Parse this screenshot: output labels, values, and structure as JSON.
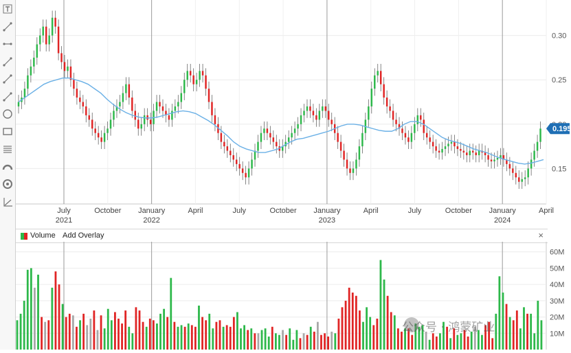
{
  "chart_data": [
    {
      "type": "candlestick",
      "title": "",
      "y_ticks": [
        "0.30",
        "0.25",
        "0.20",
        "0.15"
      ],
      "ylim": [
        0.11,
        0.34
      ],
      "last_price_label": "0.195",
      "x_labels": [
        {
          "month": "July",
          "year": "2021"
        },
        {
          "month": "October",
          "year": ""
        },
        {
          "month": "January",
          "year": "2022"
        },
        {
          "month": "April",
          "year": ""
        },
        {
          "month": "July",
          "year": ""
        },
        {
          "month": "October",
          "year": ""
        },
        {
          "month": "January",
          "year": "2023"
        },
        {
          "month": "April",
          "year": ""
        },
        {
          "month": "July",
          "year": ""
        },
        {
          "month": "October",
          "year": ""
        },
        {
          "month": "January",
          "year": "2024"
        },
        {
          "month": "April",
          "year": ""
        }
      ],
      "series": [
        {
          "style": "candle",
          "close": [
            0.225,
            0.23,
            0.24,
            0.255,
            0.265,
            0.275,
            0.29,
            0.3,
            0.31,
            0.29,
            0.3,
            0.32,
            0.31,
            0.28,
            0.27,
            0.26,
            0.265,
            0.25,
            0.24,
            0.23,
            0.225,
            0.22,
            0.21,
            0.205,
            0.195,
            0.19,
            0.185,
            0.18,
            0.19,
            0.195,
            0.205,
            0.215,
            0.22,
            0.225,
            0.235,
            0.245,
            0.23,
            0.215,
            0.205,
            0.195,
            0.2,
            0.21,
            0.205,
            0.2,
            0.215,
            0.225,
            0.22,
            0.215,
            0.21,
            0.205,
            0.215,
            0.22,
            0.225,
            0.235,
            0.25,
            0.26,
            0.255,
            0.245,
            0.25,
            0.26,
            0.255,
            0.24,
            0.225,
            0.21,
            0.2,
            0.19,
            0.18,
            0.175,
            0.17,
            0.165,
            0.16,
            0.155,
            0.15,
            0.145,
            0.14,
            0.15,
            0.16,
            0.17,
            0.18,
            0.19,
            0.195,
            0.19,
            0.185,
            0.18,
            0.175,
            0.17,
            0.175,
            0.18,
            0.185,
            0.19,
            0.195,
            0.2,
            0.21,
            0.215,
            0.22,
            0.215,
            0.21,
            0.205,
            0.215,
            0.22,
            0.215,
            0.205,
            0.2,
            0.19,
            0.18,
            0.17,
            0.16,
            0.15,
            0.145,
            0.15,
            0.16,
            0.175,
            0.19,
            0.205,
            0.22,
            0.24,
            0.255,
            0.26,
            0.245,
            0.23,
            0.22,
            0.215,
            0.205,
            0.2,
            0.195,
            0.19,
            0.185,
            0.18,
            0.19,
            0.2,
            0.21,
            0.205,
            0.19,
            0.185,
            0.18,
            0.175,
            0.17,
            0.168,
            0.172,
            0.175,
            0.178,
            0.18,
            0.175,
            0.172,
            0.17,
            0.168,
            0.165,
            0.17,
            0.168,
            0.165,
            0.17,
            0.168,
            0.165,
            0.16,
            0.158,
            0.16,
            0.162,
            0.165,
            0.16,
            0.155,
            0.15,
            0.145,
            0.14,
            0.135,
            0.138,
            0.14,
            0.15,
            0.16,
            0.17,
            0.18,
            0.195
          ],
          "open": [
            0.22,
            0.225,
            0.23,
            0.24,
            0.255,
            0.265,
            0.275,
            0.29,
            0.3,
            0.31,
            0.29,
            0.3,
            0.32,
            0.31,
            0.28,
            0.27,
            0.26,
            0.265,
            0.25,
            0.24,
            0.23,
            0.225,
            0.22,
            0.21,
            0.205,
            0.195,
            0.19,
            0.185,
            0.18,
            0.19,
            0.195,
            0.205,
            0.215,
            0.22,
            0.225,
            0.235,
            0.245,
            0.23,
            0.215,
            0.205,
            0.195,
            0.2,
            0.21,
            0.205,
            0.2,
            0.215,
            0.225,
            0.22,
            0.215,
            0.21,
            0.205,
            0.215,
            0.22,
            0.225,
            0.235,
            0.25,
            0.26,
            0.255,
            0.245,
            0.25,
            0.26,
            0.255,
            0.24,
            0.225,
            0.21,
            0.2,
            0.19,
            0.18,
            0.175,
            0.17,
            0.165,
            0.16,
            0.155,
            0.15,
            0.145,
            0.14,
            0.15,
            0.16,
            0.17,
            0.18,
            0.19,
            0.195,
            0.19,
            0.185,
            0.18,
            0.175,
            0.17,
            0.175,
            0.18,
            0.185,
            0.19,
            0.195,
            0.2,
            0.21,
            0.215,
            0.22,
            0.215,
            0.21,
            0.205,
            0.215,
            0.22,
            0.215,
            0.205,
            0.2,
            0.19,
            0.18,
            0.17,
            0.16,
            0.15,
            0.145,
            0.15,
            0.16,
            0.175,
            0.19,
            0.205,
            0.22,
            0.24,
            0.255,
            0.26,
            0.245,
            0.23,
            0.22,
            0.215,
            0.205,
            0.2,
            0.195,
            0.19,
            0.185,
            0.18,
            0.19,
            0.2,
            0.21,
            0.205,
            0.19,
            0.185,
            0.18,
            0.175,
            0.17,
            0.168,
            0.172,
            0.175,
            0.178,
            0.18,
            0.175,
            0.172,
            0.17,
            0.168,
            0.165,
            0.17,
            0.168,
            0.165,
            0.17,
            0.168,
            0.165,
            0.16,
            0.158,
            0.16,
            0.162,
            0.165,
            0.16,
            0.155,
            0.15,
            0.145,
            0.14,
            0.135,
            0.138,
            0.14,
            0.15,
            0.16,
            0.17,
            0.18
          ]
        },
        {
          "style": "line",
          "color": "#6ab0e6",
          "values": [
            0.225,
            0.23,
            0.235,
            0.24,
            0.245,
            0.248,
            0.25,
            0.252,
            0.252,
            0.25,
            0.248,
            0.245,
            0.24,
            0.235,
            0.228,
            0.222,
            0.217,
            0.213,
            0.21,
            0.208,
            0.207,
            0.207,
            0.208,
            0.21,
            0.212,
            0.214,
            0.215,
            0.214,
            0.212,
            0.208,
            0.204,
            0.199,
            0.193,
            0.187,
            0.18,
            0.175,
            0.172,
            0.17,
            0.168,
            0.168,
            0.17,
            0.172,
            0.176,
            0.18,
            0.183,
            0.184,
            0.186,
            0.188,
            0.19,
            0.192,
            0.195,
            0.198,
            0.2,
            0.2,
            0.199,
            0.197,
            0.195,
            0.193,
            0.192,
            0.192,
            0.195,
            0.2,
            0.203,
            0.203,
            0.2,
            0.195,
            0.19,
            0.185,
            0.182,
            0.18,
            0.178,
            0.175,
            0.172,
            0.17,
            0.168,
            0.165,
            0.162,
            0.16,
            0.158,
            0.156,
            0.155,
            0.156,
            0.158,
            0.16
          ]
        }
      ]
    },
    {
      "type": "bar",
      "title": "",
      "y_ticks": [
        "60M",
        "50M",
        "40M",
        "30M",
        "20M",
        "10M"
      ],
      "ylim": [
        0,
        62
      ],
      "values": [
        18,
        22,
        30,
        49,
        50,
        38,
        46,
        20,
        17,
        18,
        38,
        48,
        40,
        28,
        20,
        22,
        21,
        14,
        18,
        22,
        15,
        19,
        24,
        12,
        21,
        13,
        25,
        18,
        23,
        19,
        16,
        24,
        14,
        10,
        26,
        24,
        17,
        14,
        19,
        18,
        16,
        22,
        25,
        20,
        44,
        17,
        14,
        15,
        14,
        16,
        15,
        14,
        27,
        20,
        18,
        22,
        13,
        17,
        18,
        14,
        15,
        14,
        20,
        23,
        13,
        15,
        12,
        13,
        10,
        10,
        12,
        13,
        8,
        14,
        10,
        9,
        12,
        9,
        13,
        6,
        12,
        7,
        10,
        9,
        14,
        11,
        17,
        9,
        10,
        8,
        11,
        10,
        19,
        26,
        30,
        38,
        35,
        33,
        24,
        17,
        26,
        20,
        15,
        19,
        55,
        43,
        33,
        23,
        21,
        13,
        11,
        13,
        13,
        9,
        16,
        14,
        15,
        11,
        6,
        10,
        8,
        10,
        17,
        14,
        7,
        13,
        9,
        10,
        12,
        8,
        11,
        14,
        12,
        9,
        15,
        17,
        7,
        22,
        45,
        35,
        28,
        20,
        18,
        24,
        13,
        26,
        22,
        22,
        10,
        30,
        18
      ],
      "colors": [
        "g",
        "g",
        "g",
        "g",
        "g",
        "gr",
        "g",
        "r",
        "gr",
        "r",
        "g",
        "r",
        "r",
        "g",
        "r",
        "r",
        "gr",
        "r",
        "g",
        "r",
        "gr",
        "gr",
        "r",
        "gr",
        "r",
        "g",
        "g",
        "g",
        "r",
        "r",
        "r",
        "r",
        "g",
        "g",
        "r",
        "r",
        "r",
        "g",
        "r",
        "r",
        "g",
        "g",
        "g",
        "r",
        "g",
        "r",
        "g",
        "g",
        "r",
        "g",
        "r",
        "r",
        "g",
        "r",
        "r",
        "g",
        "g",
        "r",
        "r",
        "g",
        "r",
        "r",
        "r",
        "g",
        "g",
        "g",
        "r",
        "g",
        "r",
        "gr",
        "g",
        "g",
        "g",
        "r",
        "g",
        "g",
        "gr",
        "r",
        "g",
        "g",
        "g",
        "r",
        "gr",
        "r",
        "g",
        "r",
        "gr",
        "r",
        "r",
        "r",
        "gr",
        "g",
        "r",
        "r",
        "r",
        "r",
        "r",
        "r",
        "r",
        "g",
        "g",
        "g",
        "r",
        "r",
        "g",
        "g",
        "r",
        "r",
        "g",
        "r",
        "r",
        "g",
        "r",
        "r",
        "g",
        "g",
        "g",
        "gr",
        "g",
        "r",
        "r",
        "g",
        "g",
        "r",
        "g",
        "r",
        "g",
        "g",
        "r",
        "r",
        "g",
        "gr",
        "g",
        "g",
        "r",
        "r",
        "r",
        "g",
        "g",
        "g",
        "r",
        "g",
        "r",
        "r",
        "g",
        "g",
        "r",
        "g",
        "g",
        "g",
        "g"
      ]
    }
  ],
  "colors": {
    "up": "#2db84a",
    "down": "#e02424",
    "neutral": "#a8a8a8",
    "ma": "#6ab0e6",
    "last": "#1f6fb5"
  },
  "volume_header": {
    "label": "Volume",
    "overlay": "Add Overlay",
    "close": "×"
  },
  "toolbar": [
    "text-tool-icon",
    "trendline-icon",
    "ray-icon",
    "line-icon",
    "extended-line-icon",
    "arrow-line-icon",
    "circle-icon",
    "rectangle-icon",
    "fib-retracement-icon",
    "arc-icon",
    "target-icon",
    "measure-icon"
  ],
  "watermark": "公众号 · 鸿蒙矿业"
}
